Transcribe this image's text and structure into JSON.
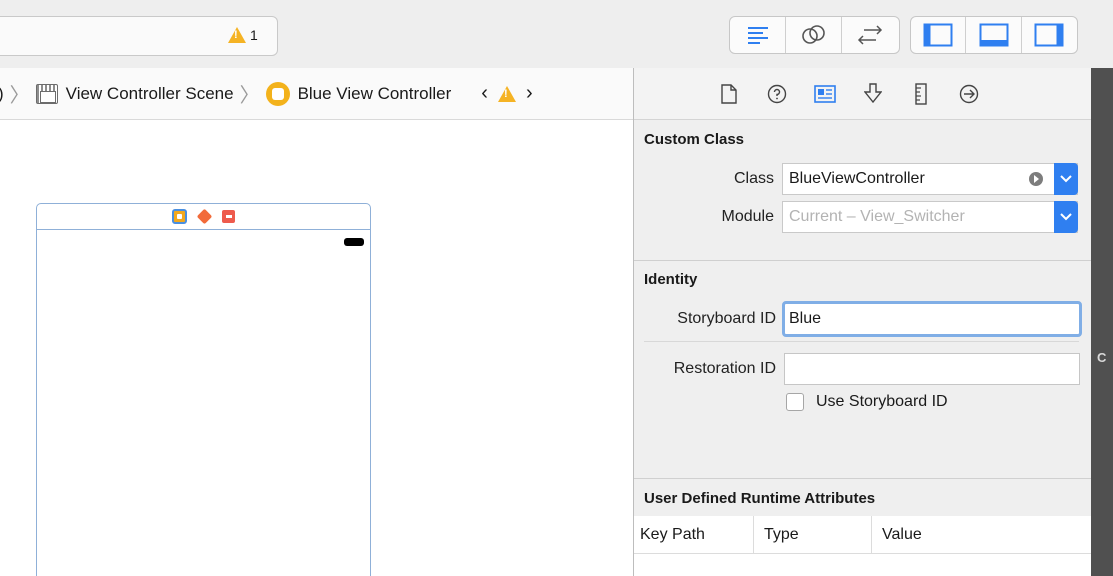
{
  "toolbar": {
    "activity_warning_count": "1",
    "editor_buttons": [
      {
        "name": "standard-editor",
        "icon": "align-lines-icon"
      },
      {
        "name": "assistant-editor",
        "icon": "venn-circles-icon"
      },
      {
        "name": "version-editor",
        "icon": "arrows-left-right-icon"
      }
    ],
    "panel_buttons": [
      {
        "name": "navigator-panel",
        "icon": "left-panel-icon"
      },
      {
        "name": "debug-panel",
        "icon": "bottom-panel-icon"
      },
      {
        "name": "utilities-panel",
        "icon": "right-panel-icon"
      }
    ],
    "accent_color": "#2f7ff0"
  },
  "jumpbar": {
    "leading_fragment": ")",
    "scene_label": "View Controller Scene",
    "controller_label": "Blue View Controller"
  },
  "inspector": {
    "custom_class": {
      "title": "Custom Class",
      "class_label": "Class",
      "class_value": "BlueViewController",
      "module_label": "Module",
      "module_placeholder": "Current – View_Switcher"
    },
    "identity": {
      "title": "Identity",
      "storyboard_id_label": "Storyboard ID",
      "storyboard_id_value": "Blue",
      "restoration_id_label": "Restoration ID",
      "restoration_id_value": "",
      "use_storyboard_id_label": "Use Storyboard ID",
      "use_storyboard_id_checked": false
    },
    "runtime_attributes": {
      "title": "User Defined Runtime Attributes",
      "columns": [
        "Key Path",
        "Type",
        "Value"
      ]
    }
  },
  "edge_strip_text": "C"
}
